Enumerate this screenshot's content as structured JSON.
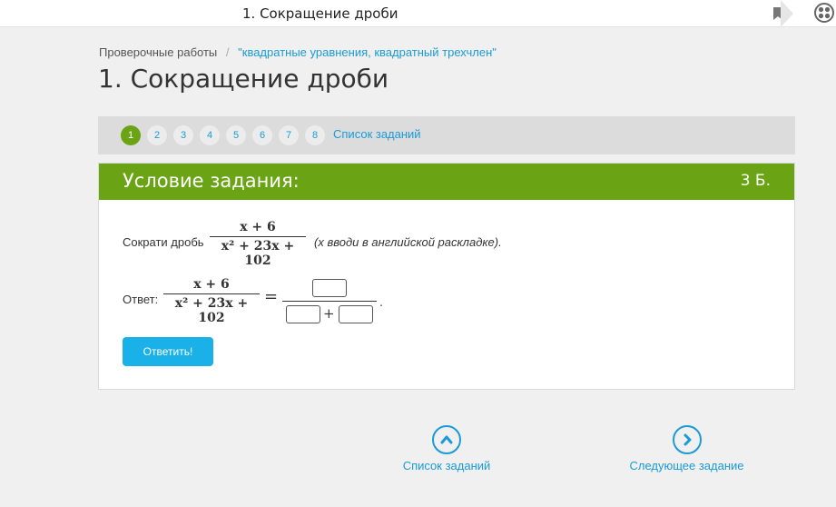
{
  "browser": {
    "tab_title": "1. Сокращение дроби",
    "bookmark_icon": "bookmark-icon",
    "extension_icon": "extension-icon"
  },
  "breadcrumb": {
    "root": "Проверочные работы",
    "separator": "/",
    "current": "\"квадратные уравнения, квадратный трехчлен\""
  },
  "page_title": "1. Сокращение дроби",
  "task_nav": {
    "numbers": [
      "1",
      "2",
      "3",
      "4",
      "5",
      "6",
      "7",
      "8"
    ],
    "active": "1",
    "list_link": "Список заданий"
  },
  "card": {
    "header_title": "Условие задания:",
    "score": "3 Б.",
    "task_prefix": "Сократи дробь",
    "fraction": {
      "numerator": "x + 6",
      "denominator": "x² + 23x + 102"
    },
    "hint": "(x вводи в английской раскладке).",
    "answer_label": "Ответ:",
    "equals": "=",
    "plus": "+",
    "period": ".",
    "submit_label": "Ответить!"
  },
  "bottom_nav": {
    "list_label": "Список заданий",
    "next_label": "Следующее задание"
  },
  "colors": {
    "accent_green": "#6aa414",
    "link_blue": "#1a9ad6",
    "button_blue": "#1ab0e8"
  }
}
